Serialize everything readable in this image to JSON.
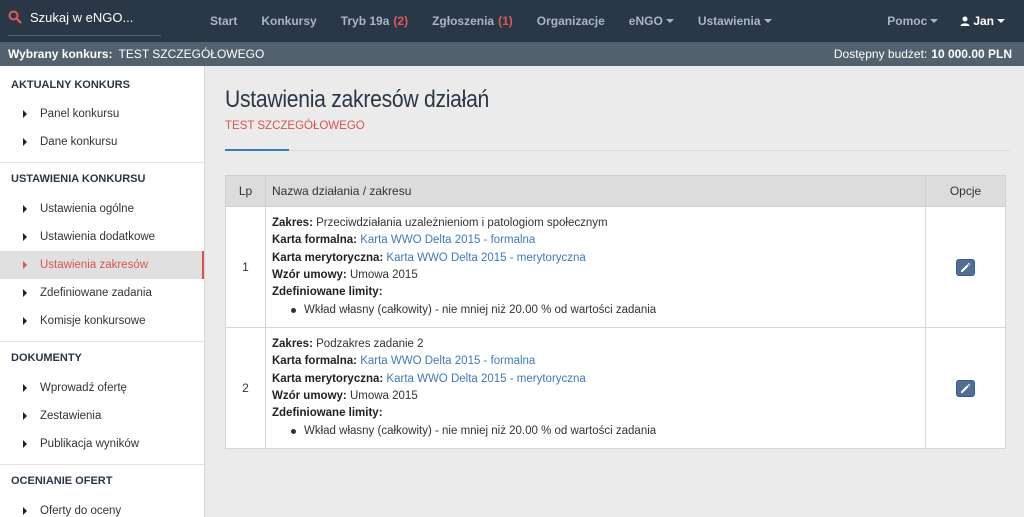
{
  "topbar": {
    "search_label": "Szukaj w eNGO...",
    "nav": [
      {
        "label": "Start"
      },
      {
        "label": "Konkursy"
      },
      {
        "label": "Tryb 19a",
        "count": "(2)"
      },
      {
        "label": "Zgłoszenia",
        "count": "(1)"
      },
      {
        "label": "Organizacje"
      },
      {
        "label": "eNGO"
      },
      {
        "label": "Ustawienia"
      }
    ],
    "help_label": "Pomoc",
    "user_label": "Jan"
  },
  "context": {
    "selected_label": "Wybrany konkurs:",
    "selected_value": "TEST SZCZEGÓŁOWEGO",
    "budget_label": "Dostępny budżet:",
    "budget_value": "10 000.00 PLN"
  },
  "sidebar": {
    "sections": [
      {
        "title": "AKTUALNY KONKURS",
        "items": [
          "Panel konkursu",
          "Dane konkursu"
        ]
      },
      {
        "title": "USTAWIENIA KONKURSU",
        "items": [
          "Ustawienia ogólne",
          "Ustawienia dodatkowe",
          "Ustawienia zakresów",
          "Zdefiniowane zadania",
          "Komisje konkursowe"
        ]
      },
      {
        "title": "DOKUMENTY",
        "items": [
          "Wprowadź ofertę",
          "Zestawienia",
          "Publikacja wyników"
        ]
      },
      {
        "title": "OCENIANIE OFERT",
        "items": [
          "Oferty do oceny"
        ]
      }
    ]
  },
  "main": {
    "title": "Ustawienia zakresów działań",
    "subtitle": "TEST SZCZEGÓŁOWEGO",
    "table": {
      "headers": {
        "lp": "Lp",
        "name": "Nazwa działania / zakresu",
        "options": "Opcje"
      },
      "rows": [
        {
          "lp": "1",
          "zakres_label": "Zakres:",
          "zakres": "Przeciwdziałania uzależnieniom i patologiom społecznym",
          "karta_formalna_label": "Karta formalna:",
          "karta_formalna": "Karta WWO Delta 2015 - formalna",
          "karta_merytoryczna_label": "Karta merytoryczna:",
          "karta_merytoryczna": "Karta WWO Delta 2015 - merytoryczna",
          "wzor_label": "Wzór umowy:",
          "wzor": "Umowa 2015",
          "limity_label": "Zdefiniowane limity:",
          "limit": "Wkład własny (całkowity) - nie mniej niż 20.00 % od wartości zadania"
        },
        {
          "lp": "2",
          "zakres_label": "Zakres:",
          "zakres": "Podzakres zadanie 2",
          "karta_formalna_label": "Karta formalna:",
          "karta_formalna": "Karta WWO Delta 2015 - formalna",
          "karta_merytoryczna_label": "Karta merytoryczna:",
          "karta_merytoryczna": "Karta WWO Delta 2015 - merytoryczna",
          "wzor_label": "Wzór umowy:",
          "wzor": "Umowa 2015",
          "limity_label": "Zdefiniowane limity:",
          "limit": "Wkład własny (całkowity) - nie mniej niż 20.00 % od wartości zadania"
        }
      ]
    }
  },
  "icons": {
    "search": "search-icon",
    "edit": "pencil-icon",
    "user": "user-icon"
  },
  "colors": {
    "navbar": "#2a3746",
    "accent_red": "#d9534f",
    "link": "#3f7ab8",
    "edit_button": "#4f6f93"
  }
}
